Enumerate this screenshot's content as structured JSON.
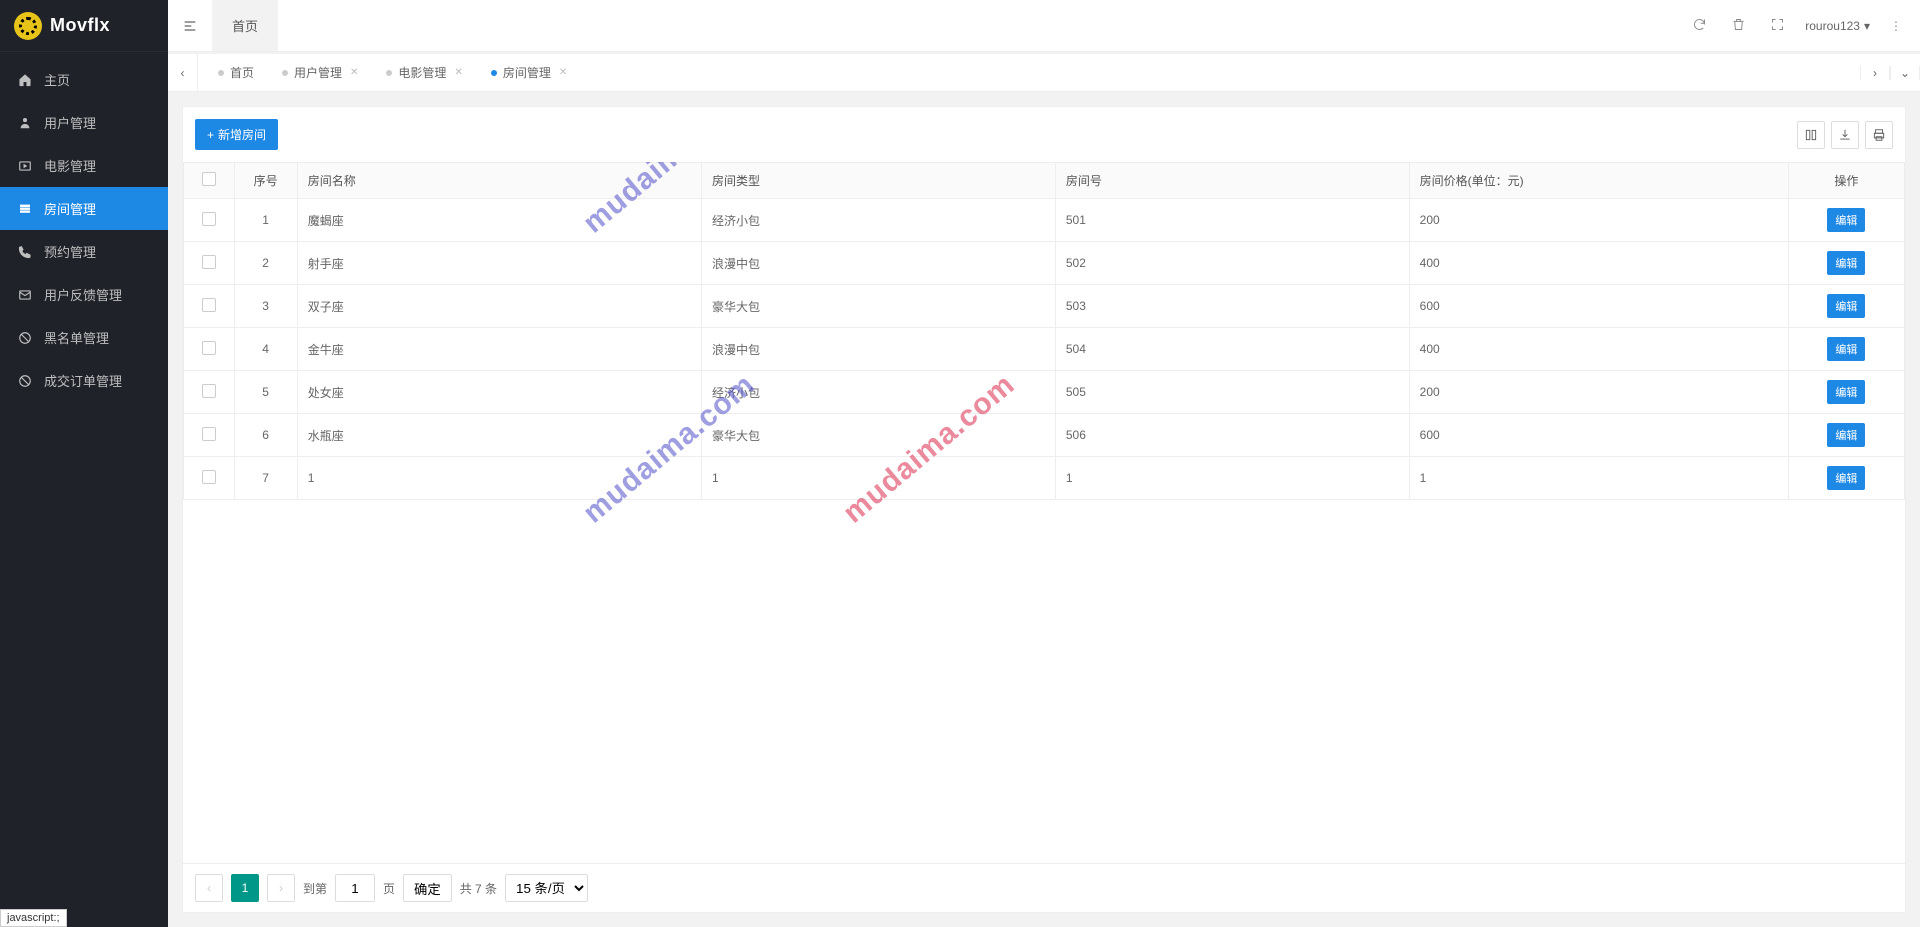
{
  "brand": "Movflx",
  "sidebar": {
    "items": [
      {
        "label": "主页",
        "icon": "home"
      },
      {
        "label": "用户管理",
        "icon": "user"
      },
      {
        "label": "电影管理",
        "icon": "play"
      },
      {
        "label": "房间管理",
        "icon": "list",
        "active": true
      },
      {
        "label": "预约管理",
        "icon": "phone"
      },
      {
        "label": "用户反馈管理",
        "icon": "mail"
      },
      {
        "label": "黑名单管理",
        "icon": "ban"
      },
      {
        "label": "成交订单管理",
        "icon": "ban"
      }
    ]
  },
  "topbar": {
    "home_tab": "首页",
    "username": "rourou123"
  },
  "tabstrip": {
    "tabs": [
      {
        "label": "首页",
        "closable": false
      },
      {
        "label": "用户管理",
        "closable": true
      },
      {
        "label": "电影管理",
        "closable": true
      },
      {
        "label": "房间管理",
        "closable": true,
        "active": true
      }
    ]
  },
  "toolbar": {
    "add_label": "新增房间"
  },
  "table": {
    "headers": {
      "index": "序号",
      "name": "房间名称",
      "type": "房间类型",
      "number": "房间号",
      "price": "房间价格(单位：元)",
      "op": "操作"
    },
    "edit_label": "编辑",
    "rows": [
      {
        "idx": "1",
        "name": "魔蝎座",
        "type": "经济小包",
        "number": "501",
        "price": "200"
      },
      {
        "idx": "2",
        "name": "射手座",
        "type": "浪漫中包",
        "number": "502",
        "price": "400"
      },
      {
        "idx": "3",
        "name": "双子座",
        "type": "豪华大包",
        "number": "503",
        "price": "600"
      },
      {
        "idx": "4",
        "name": "金牛座",
        "type": "浪漫中包",
        "number": "504",
        "price": "400"
      },
      {
        "idx": "5",
        "name": "处女座",
        "type": "经济小包",
        "number": "505",
        "price": "200"
      },
      {
        "idx": "6",
        "name": "水瓶座",
        "type": "豪华大包",
        "number": "506",
        "price": "600"
      },
      {
        "idx": "7",
        "name": "1",
        "type": "1",
        "number": "1",
        "price": "1"
      }
    ]
  },
  "pagination": {
    "current": "1",
    "goto_label": "到第",
    "goto_value": "1",
    "page_suffix": "页",
    "confirm": "确定",
    "total": "共 7 条",
    "page_size": "15 条/页"
  },
  "status_bar": "javascript:;",
  "watermark": "mudaima.com"
}
